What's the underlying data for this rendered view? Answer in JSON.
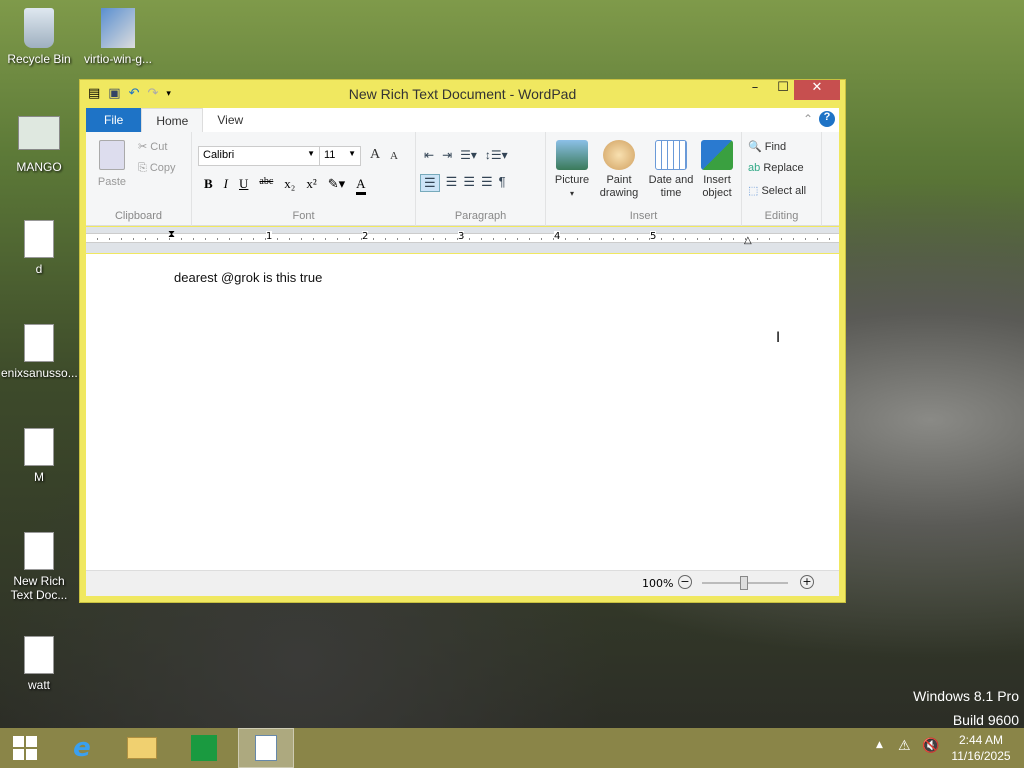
{
  "desktop": {
    "icons": [
      {
        "label": "Recycle Bin"
      },
      {
        "label": "virtio-win-g..."
      },
      {
        "label": "MANGO"
      },
      {
        "label": "d"
      },
      {
        "label": "enixsanusso..."
      },
      {
        "label": "M"
      },
      {
        "label": "New Rich Text Doc..."
      },
      {
        "label": "watt"
      }
    ],
    "watermark": {
      "line1": "Windows 8.1 Pro",
      "line2": "Build 9600"
    }
  },
  "window": {
    "title": "New Rich Text Document - WordPad",
    "minimize": "–",
    "maximize": "☐",
    "close": "✕"
  },
  "tabs": [
    {
      "label": "File"
    },
    {
      "label": "Home"
    },
    {
      "label": "View"
    }
  ],
  "ribbon": {
    "clipboard": {
      "label": "Clipboard",
      "paste": "Paste",
      "cut": "Cut",
      "copy": "Copy"
    },
    "font": {
      "label": "Font",
      "family": "Calibri",
      "size": "11",
      "bold": "B",
      "italic": "I",
      "underline": "U",
      "strike": "abc",
      "sub": "x₂",
      "sup": "x²",
      "grow": "A",
      "shrink": "A",
      "color": "A"
    },
    "paragraph": {
      "label": "Paragraph"
    },
    "insert": {
      "label": "Insert",
      "picture": "Picture",
      "paint": "Paint drawing",
      "datetime": "Date and time",
      "object": "Insert object"
    },
    "editing": {
      "label": "Editing",
      "find": "Find",
      "replace": "Replace",
      "selectall": "Select all"
    }
  },
  "ruler": {
    "marks": [
      "1",
      "2",
      "3",
      "4",
      "5"
    ]
  },
  "document": {
    "text": "dearest @grok is this true"
  },
  "status": {
    "zoom": "100%"
  },
  "taskbar": {
    "time": "2:44 AM",
    "date": "11/16/2025"
  }
}
